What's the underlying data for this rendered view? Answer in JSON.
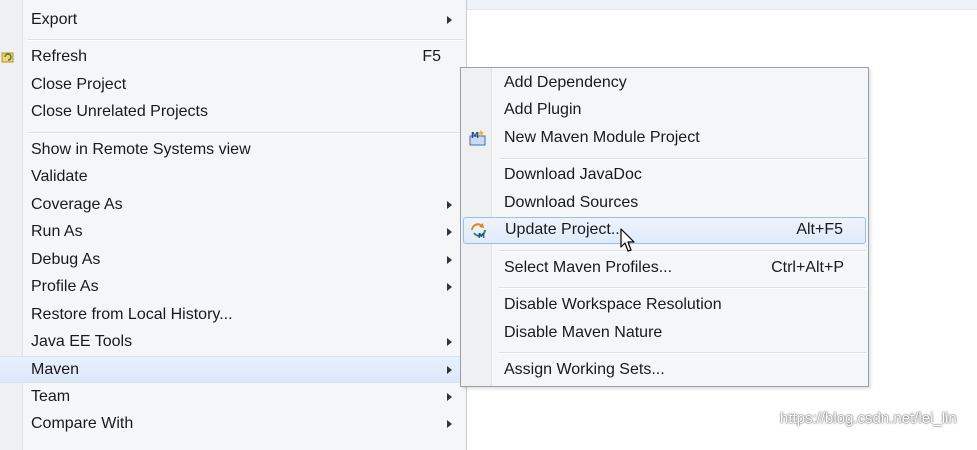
{
  "context_menu": {
    "items": [
      {
        "label": "Export"
      },
      {
        "label": "Refresh",
        "shortcut": "F5"
      },
      {
        "label": "Close Project"
      },
      {
        "label": "Close Unrelated Projects"
      },
      {
        "label": "Show in Remote Systems view"
      },
      {
        "label": "Validate"
      },
      {
        "label": "Coverage As"
      },
      {
        "label": "Run As"
      },
      {
        "label": "Debug As"
      },
      {
        "label": "Profile As"
      },
      {
        "label": "Restore from Local History..."
      },
      {
        "label": "Java EE Tools"
      },
      {
        "label": "Maven"
      },
      {
        "label": "Team"
      },
      {
        "label": "Compare With"
      }
    ]
  },
  "maven_submenu": {
    "items": [
      {
        "label": "Add Dependency"
      },
      {
        "label": "Add Plugin"
      },
      {
        "label": "New Maven Module Project",
        "icon": "maven-module-icon"
      },
      {
        "label": "Download JavaDoc"
      },
      {
        "label": "Download Sources"
      },
      {
        "label": "Update Project...",
        "shortcut": "Alt+F5",
        "icon": "maven-update-icon"
      },
      {
        "label": "Select Maven Profiles...",
        "shortcut": "Ctrl+Alt+P"
      },
      {
        "label": "Disable Workspace Resolution"
      },
      {
        "label": "Disable Maven Nature"
      },
      {
        "label": "Assign Working Sets..."
      }
    ]
  },
  "watermark": "https://blog.csdn.net/lei_lin",
  "colors": {
    "highlight": "#dce8fa",
    "highlight_border": "#9ebde8",
    "menu_bg": "#f5f6f7"
  }
}
